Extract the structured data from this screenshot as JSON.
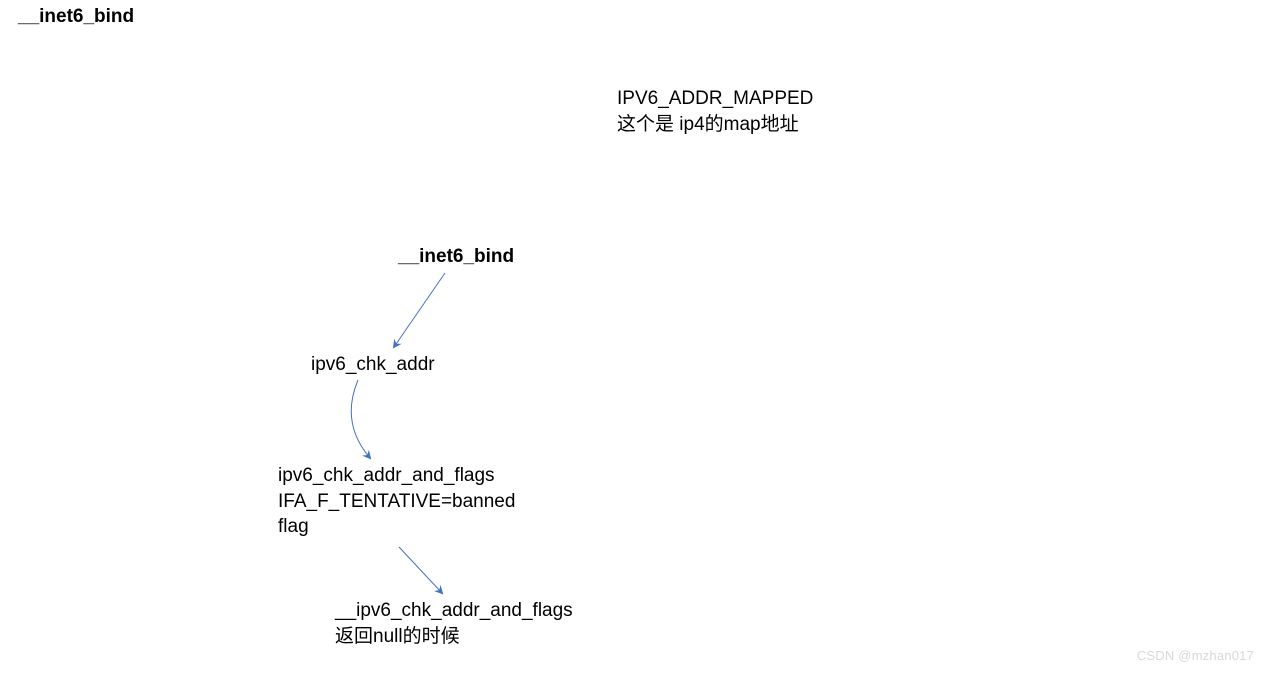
{
  "title": "__inet6_bind",
  "note": {
    "line1": "IPV6_ADDR_MAPPED",
    "line2": "这个是 ip4的map地址"
  },
  "flow": {
    "root": "__inet6_bind",
    "n1": "ipv6_chk_addr",
    "n2_line1": "ipv6_chk_addr_and_flags",
    "n2_line2": "IFA_F_TENTATIVE=banned",
    "n2_line3": "flag",
    "n3_line1": "__ipv6_chk_addr_and_flags",
    "n3_line2": "返回null的时候"
  },
  "watermark": "CSDN @mzhan017",
  "arrow_color": "#4472C4"
}
